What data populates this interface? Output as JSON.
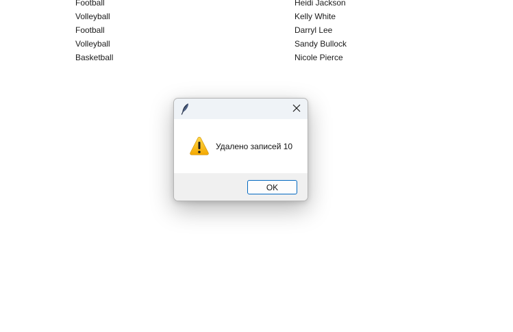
{
  "background_table": {
    "rows": [
      {
        "sport": "Football",
        "name": "Heidi Jackson"
      },
      {
        "sport": "Volleyball",
        "name": "Kelly White"
      },
      {
        "sport": "Football",
        "name": "Darryl Lee"
      },
      {
        "sport": "Volleyball",
        "name": "Sandy Bullock"
      },
      {
        "sport": "Basketball",
        "name": "Nicole Pierce"
      }
    ]
  },
  "dialog": {
    "title": "",
    "title_icon": "feather-icon",
    "close_icon": "close-icon",
    "message_icon": "warning-icon",
    "message": "Удалено записей 10",
    "ok_label": "OK",
    "colors": {
      "accent": "#0067c0",
      "warning": "#f9b800",
      "titlebar": "#eff3f7",
      "footer": "#f0f0f0"
    }
  }
}
